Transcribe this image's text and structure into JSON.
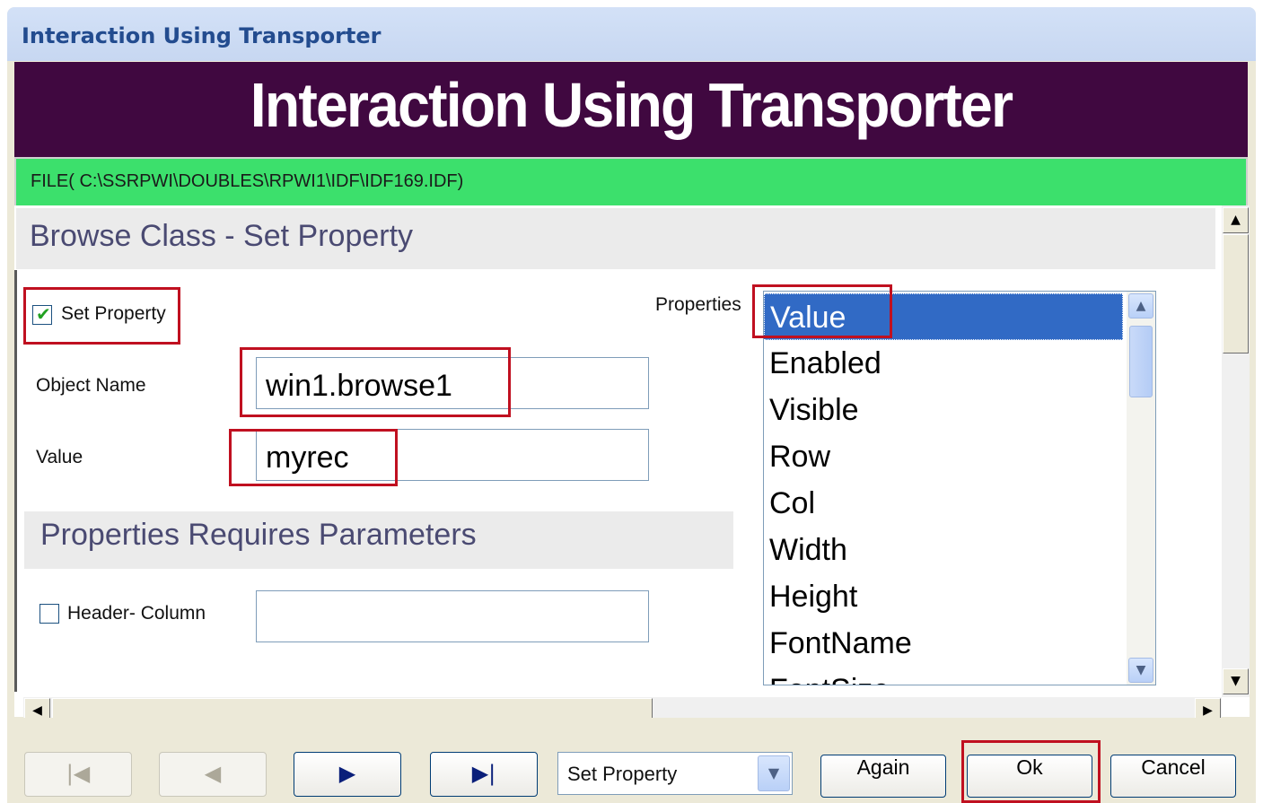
{
  "window": {
    "title": "Interaction Using Transporter"
  },
  "banner": {
    "title": "Interaction Using Transporter"
  },
  "file": {
    "path": "FILE( C:\\SSRPWI\\DOUBLES\\RPWI1\\IDF\\IDF169.IDF)"
  },
  "section": {
    "title": "Browse Class - Set Property"
  },
  "set_property": {
    "label": "Set Property",
    "checked": true
  },
  "object_name": {
    "label": "Object Name",
    "value": "win1.browse1"
  },
  "value_field": {
    "label": "Value",
    "value": "myrec"
  },
  "params": {
    "title": "Properties Requires Parameters"
  },
  "header_column": {
    "label": "Header- Column",
    "checked": false,
    "value": ""
  },
  "properties": {
    "label": "Properties",
    "selected": "Value",
    "items": [
      "Value",
      "Enabled",
      "Visible",
      "Row",
      "Col",
      "Width",
      "Height",
      "FontName",
      "FontSize"
    ]
  },
  "bottom": {
    "action_select": "Set Property",
    "again_label": "Again",
    "ok_label": "Ok",
    "cancel_label": "Cancel"
  },
  "icons": {
    "first": "first-record-icon",
    "prev": "previous-record-icon",
    "next": "next-record-icon",
    "last": "last-record-icon",
    "check": "checkmark-icon"
  },
  "colors": {
    "banner": "#400840",
    "file_bar": "#3ce06c",
    "selection": "#316ac5",
    "highlight_box": "#c01020"
  }
}
